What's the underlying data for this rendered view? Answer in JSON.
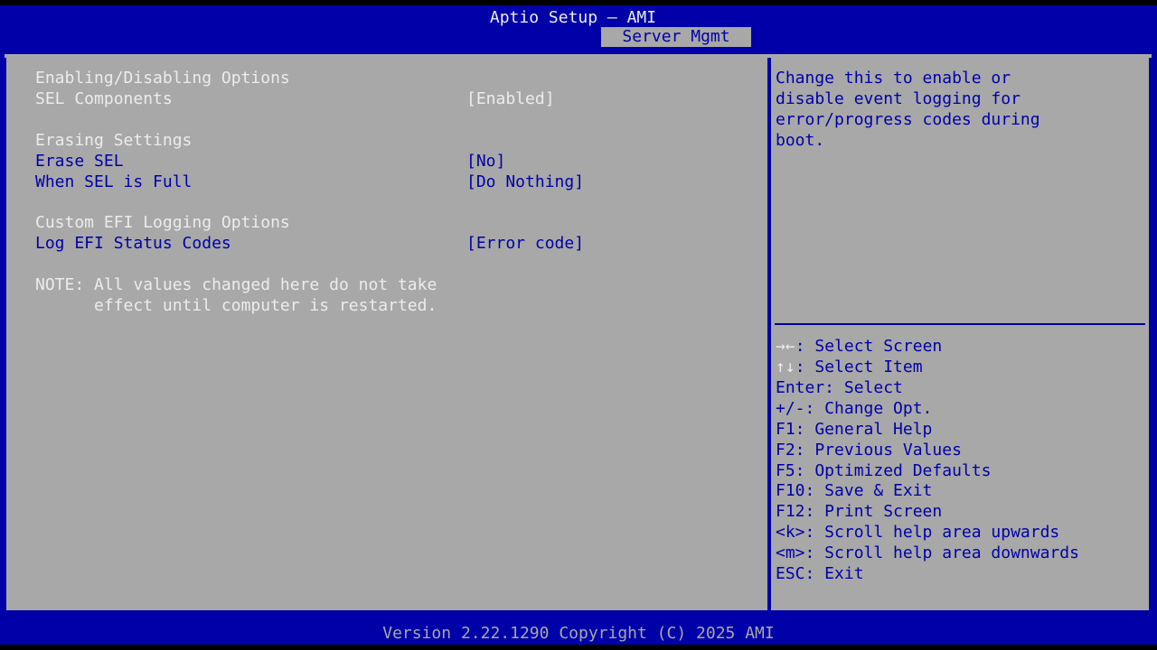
{
  "header": {
    "title": "Aptio Setup – AMI",
    "active_tab": "Server Mgmt"
  },
  "main": {
    "section_logging": "Enabling/Disabling Options",
    "sel_components": {
      "label": "SEL Components",
      "value": "[Enabled]"
    },
    "section_erasing": "Erasing Settings",
    "erase_sel": {
      "label": "Erase SEL",
      "value": "[No]"
    },
    "when_full": {
      "label": "When SEL is Full",
      "value": "[Do Nothing]"
    },
    "section_custom": "Custom EFI Logging Options",
    "log_efi": {
      "label": "Log EFI Status Codes",
      "value": "[Error code]"
    },
    "note_line1": "NOTE: All values changed here do not take",
    "note_line2": "      effect until computer is restarted."
  },
  "help": {
    "description": [
      "Change this to enable or",
      "disable event logging for",
      "error/progress codes during",
      "boot."
    ],
    "keys": [
      {
        "key": "→←",
        "desc": ": Select Screen"
      },
      {
        "key": "↑↓",
        "desc": ": Select Item"
      },
      {
        "key": "",
        "desc": "Enter: Select"
      },
      {
        "key": "",
        "desc": "+/-: Change Opt."
      },
      {
        "key": "",
        "desc": "F1: General Help"
      },
      {
        "key": "",
        "desc": "F2: Previous Values"
      },
      {
        "key": "",
        "desc": "F5: Optimized Defaults"
      },
      {
        "key": "",
        "desc": "F10: Save & Exit"
      },
      {
        "key": "",
        "desc": "F12: Print Screen"
      },
      {
        "key": "",
        "desc": "<k>: Scroll help area upwards"
      },
      {
        "key": "",
        "desc": "<m>: Scroll help area downwards"
      },
      {
        "key": "",
        "desc": "ESC: Exit"
      }
    ]
  },
  "footer": {
    "text": "Version 2.22.1290 Copyright (C) 2025 AMI"
  },
  "colors": {
    "background_blue": "#0000a8",
    "panel_gray": "#a8a8a8",
    "highlight_white": "#ececec"
  }
}
